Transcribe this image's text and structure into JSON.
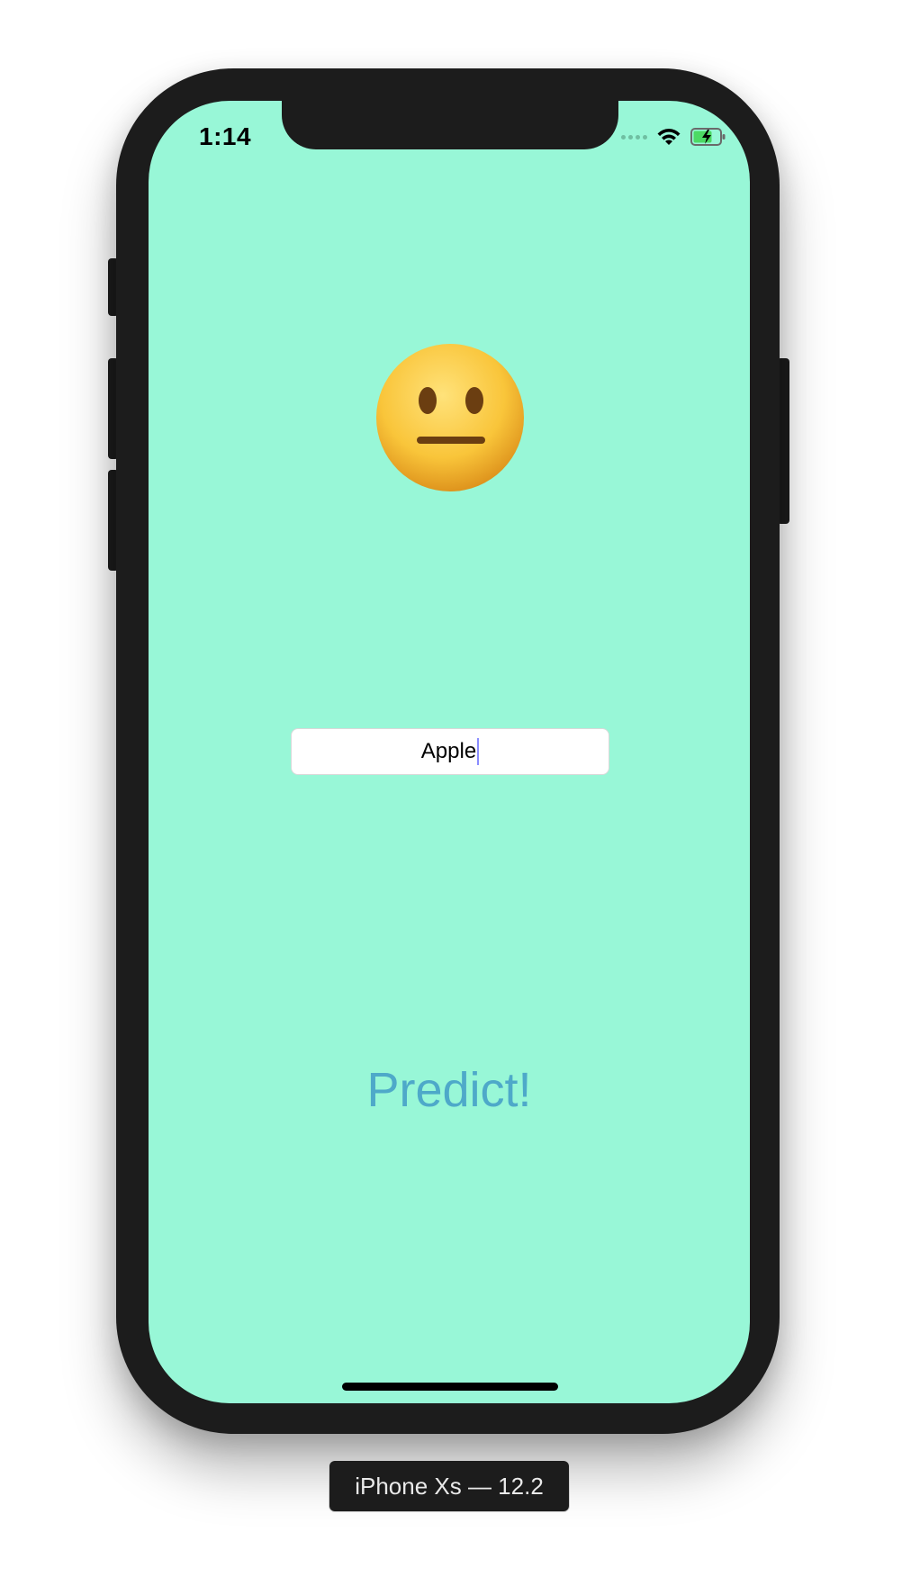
{
  "status_bar": {
    "time": "1:14",
    "icons": [
      "cellular-signal-icon",
      "wifi-icon",
      "battery-charging-icon"
    ]
  },
  "main": {
    "emoji_icon": "neutral-face-icon",
    "text_field": {
      "value": "Apple",
      "placeholder": ""
    },
    "predict_button": {
      "label": "Predict!"
    }
  },
  "simulator": {
    "device_label": "iPhone Xs — 12.2"
  },
  "colors": {
    "screen_background": "#98f7d7",
    "button_text": "#4ea9c9",
    "device_frame": "#1c1c1c"
  }
}
